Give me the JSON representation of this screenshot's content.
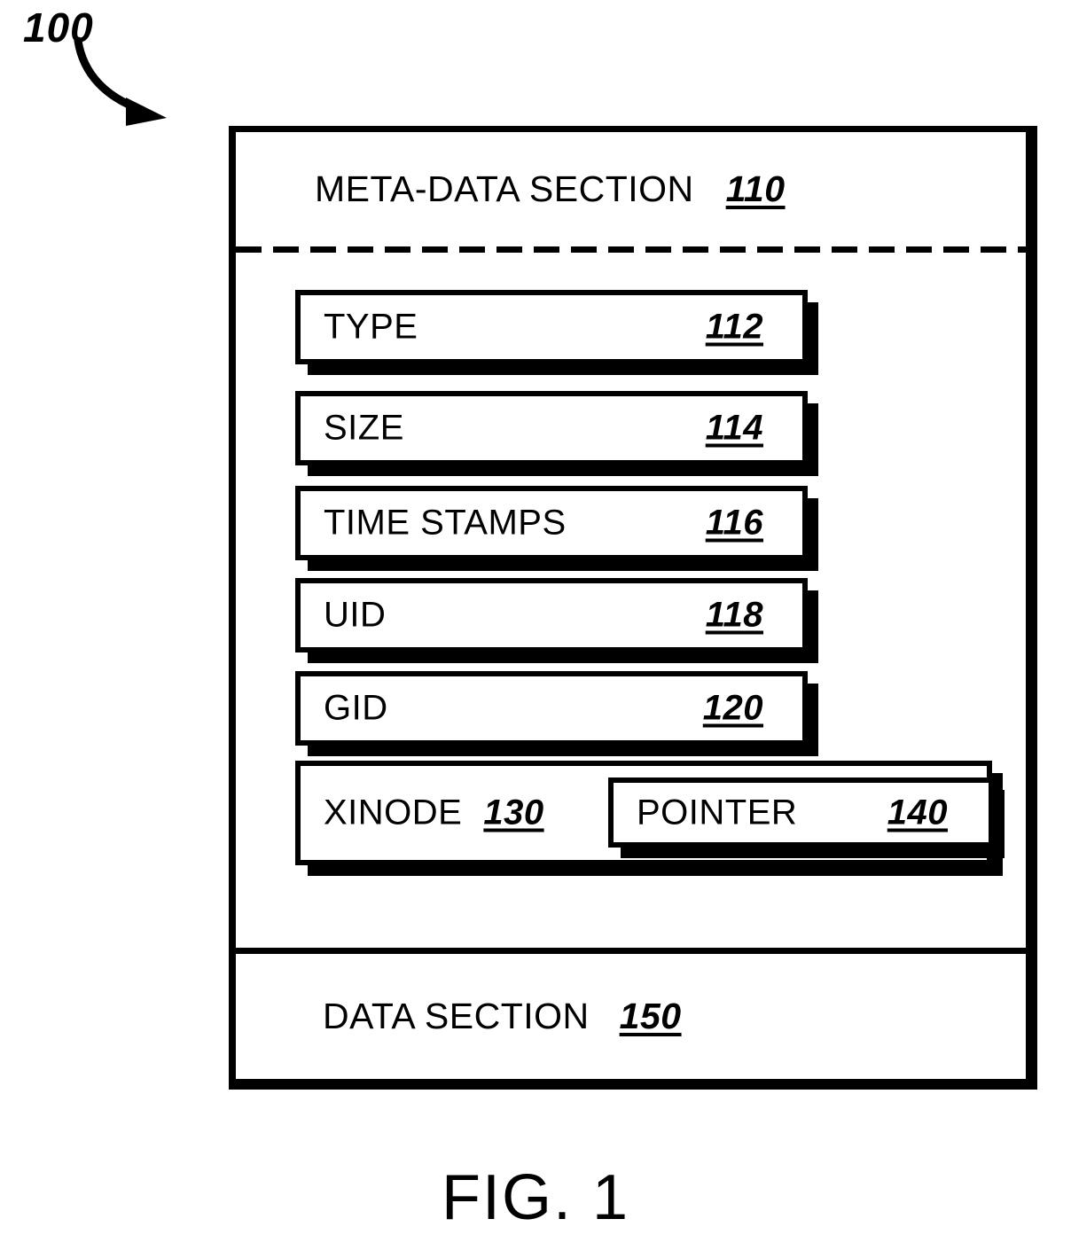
{
  "figure": {
    "caption": "FIG. 1",
    "root_ref": "100"
  },
  "outer_box": {
    "meta_header": {
      "label": "META-DATA SECTION",
      "ref": "110"
    },
    "fields": [
      {
        "label": "TYPE",
        "ref": "112"
      },
      {
        "label": "SIZE",
        "ref": "114"
      },
      {
        "label": "TIME STAMPS",
        "ref": "116"
      },
      {
        "label": "UID",
        "ref": "118"
      },
      {
        "label": "GID",
        "ref": "120"
      }
    ],
    "xinode": {
      "label": "XINODE",
      "ref": "130",
      "pointer": {
        "label": "POINTER",
        "ref": "140"
      }
    },
    "data_section": {
      "label": "DATA SECTION",
      "ref": "150"
    }
  },
  "colors": {
    "ink": "#000000",
    "paper": "#ffffff"
  }
}
